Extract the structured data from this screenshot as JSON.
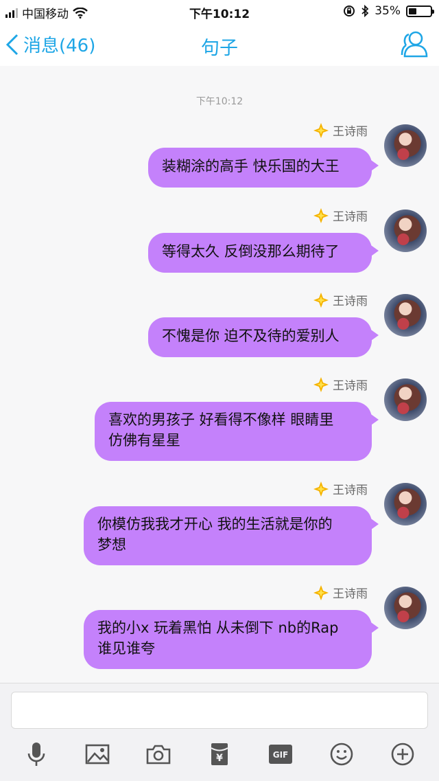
{
  "status_bar": {
    "carrier": "中国移动",
    "time": "下午10:12",
    "battery_percent": "35%",
    "battery_level": 0.35,
    "icons": [
      "signal-icon",
      "wifi-icon",
      "lock-rotation-icon",
      "bluetooth-icon",
      "battery-icon"
    ]
  },
  "nav": {
    "back_label": "消息(46)",
    "title": "句子",
    "profile_icon": "profile-icon"
  },
  "chat": {
    "timestamp": "下午10:12",
    "messages": [
      {
        "sender": "王诗雨",
        "text": "装糊涂的高手 快乐国的大王"
      },
      {
        "sender": "王诗雨",
        "text": "等得太久 反倒没那么期待了"
      },
      {
        "sender": "王诗雨",
        "text": "不愧是你 迫不及待的爱别人"
      },
      {
        "sender": "王诗雨",
        "text": "喜欢的男孩子 好看得不像样 眼睛里仿佛有星星",
        "lines": [
          "喜欢的男孩子 好看得不像样 眼睛里",
          "仿佛有星星"
        ]
      },
      {
        "sender": "王诗雨",
        "text": "你模仿我我才开心 我的生活就是你的梦想",
        "lines": [
          "你模仿我我才开心 我的生活就是你的",
          "梦想"
        ]
      },
      {
        "sender": "王诗雨",
        "text": "我的小x 玩着黑怕 从未倒下 nb的Rap谁见谁夸",
        "lines": [
          "我的小x 玩着黑怕 从未倒下 nb的Rap",
          "谁见谁夸"
        ]
      }
    ]
  },
  "input": {
    "placeholder": "",
    "gif_label": "GIF",
    "tools": [
      "microphone-icon",
      "image-icon",
      "camera-icon",
      "red-packet-icon",
      "gif-icon",
      "emoji-icon",
      "plus-icon"
    ]
  },
  "colors": {
    "accent": "#1ea6e6",
    "bubble": "#c481fb",
    "chat_bg": "#f7f7f8"
  }
}
